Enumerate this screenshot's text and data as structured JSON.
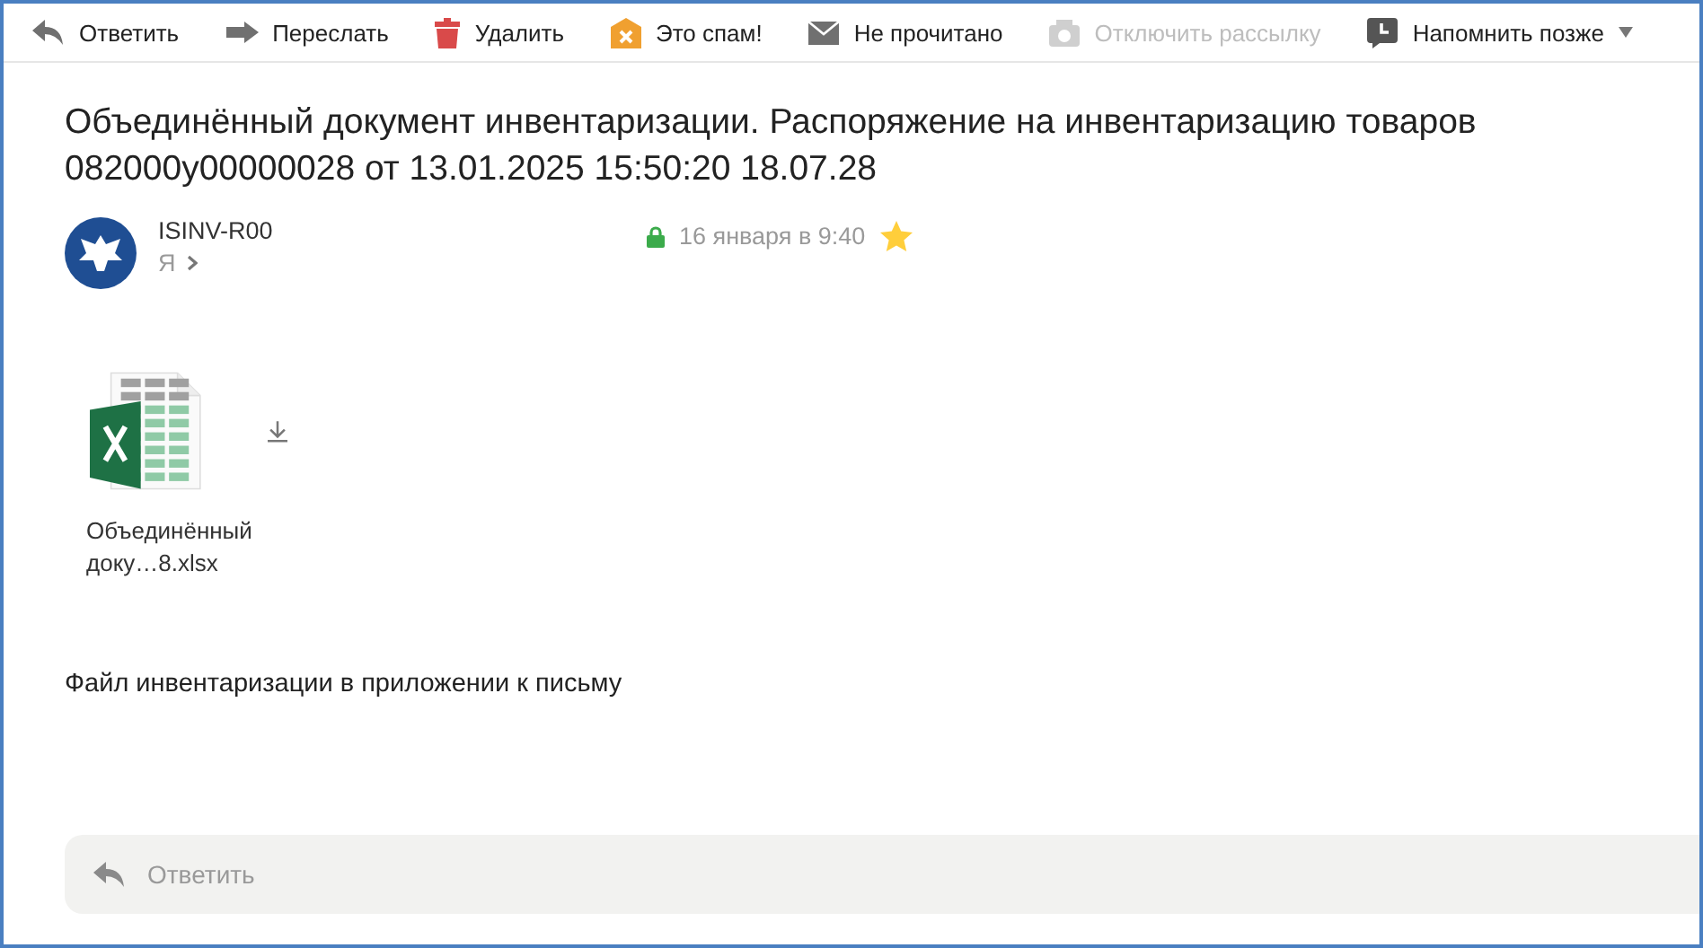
{
  "toolbar": [
    {
      "kind": "reply",
      "label": "Ответить",
      "disabled": false
    },
    {
      "kind": "forward",
      "label": "Переслать",
      "disabled": false
    },
    {
      "kind": "delete",
      "label": "Удалить",
      "disabled": false
    },
    {
      "kind": "spam",
      "label": "Это спам!",
      "disabled": false
    },
    {
      "kind": "unread",
      "label": "Не прочитано",
      "disabled": false
    },
    {
      "kind": "unsubscribe",
      "label": "Отключить рассылку",
      "disabled": true
    },
    {
      "kind": "remind",
      "label": "Напомнить позже",
      "disabled": false,
      "dropdown": true
    }
  ],
  "subject": "Объединённый документ инвентаризации. Распоряжение на инвентаризацию товаров 082000у00000028 от 13.01.2025 15:50:20 18.07.28",
  "sender": {
    "name": "ISINV-R00",
    "recipient": "Я",
    "date": "16 января в 9:40",
    "secure": true,
    "starred": true
  },
  "attachments": [
    {
      "name": "Объединённый доку…8.xlsx"
    }
  ],
  "body": "Файл инвентаризации в приложении к письму",
  "reply_bar": {
    "placeholder": "Ответить"
  }
}
